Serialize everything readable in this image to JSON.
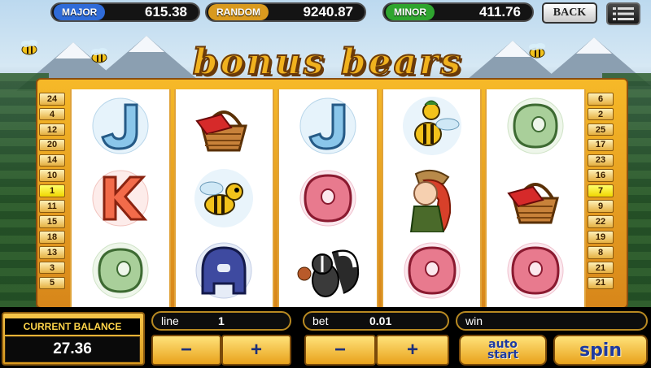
{
  "jackpots": [
    {
      "label": "MAJOR",
      "value": "615.38",
      "color": "#2f6bd8"
    },
    {
      "label": "RANDOM",
      "value": "9240.87",
      "color": "#d99a1e"
    },
    {
      "label": "MINOR",
      "value": "411.76",
      "color": "#2fa52f"
    }
  ],
  "nav": {
    "back_label": "BACK",
    "menu_icon": "menu-icon"
  },
  "logo": {
    "text": "bonus bears"
  },
  "paylines_left": [
    "24",
    "4",
    "12",
    "20",
    "14",
    "10",
    "1",
    "11",
    "15",
    "18",
    "13",
    "3",
    "5"
  ],
  "paylines_right": [
    "6",
    "2",
    "25",
    "17",
    "23",
    "16",
    "7",
    "9",
    "22",
    "19",
    "8",
    "21",
    "21"
  ],
  "reels": [
    [
      "letter-j-symbol",
      "letter-k-symbol",
      "letter-a-green-symbol"
    ],
    [
      "picnic-basket-symbol",
      "bee-symbol",
      "letter-a-blue-symbol"
    ],
    [
      "letter-j-symbol",
      "letter-q-symbol",
      "skunk-symbol"
    ],
    [
      "bee-symbol",
      "ranger-girl-symbol",
      "letter-q-symbol"
    ],
    [
      "letter-a-green-symbol",
      "picnic-basket-symbol",
      "letter-q-symbol"
    ]
  ],
  "balance": {
    "label": "CURRENT BALANCE",
    "value": "27.36"
  },
  "controls": {
    "line_label": "line",
    "line_value": "1",
    "bet_label": "bet",
    "bet_value": "0.01",
    "win_label": "win",
    "win_value": "",
    "minus": "−",
    "plus": "+",
    "auto_start_line1": "auto",
    "auto_start_line2": "start",
    "spin_label": "spin"
  }
}
